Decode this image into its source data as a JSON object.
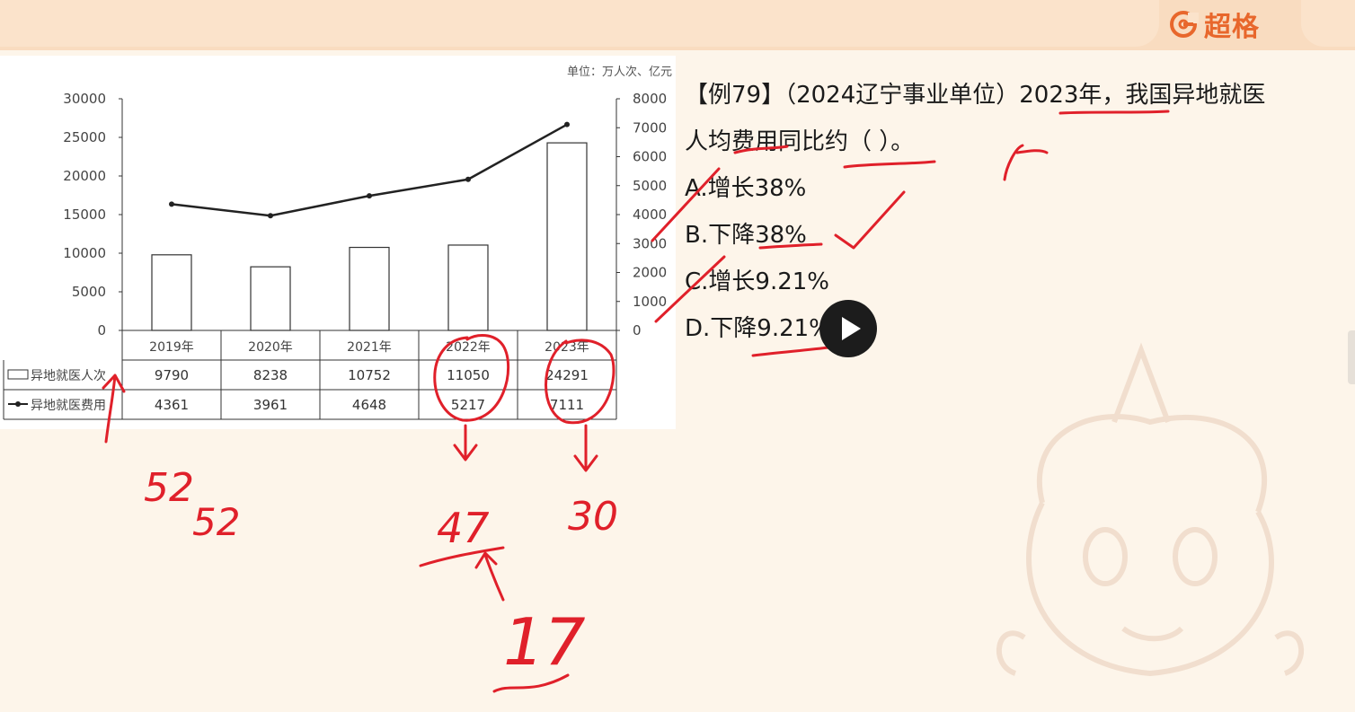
{
  "header": {
    "brand_name": "超格",
    "brand_color": "#e8672c",
    "brand_icon": "brand-logo-icon"
  },
  "chart_data": {
    "type": "bar+line",
    "unit_note": "单位：万人次、亿元",
    "categories": [
      "2019年",
      "2020年",
      "2021年",
      "2022年",
      "2023年"
    ],
    "left_axis": {
      "ticks": [
        "0",
        "5000",
        "10000",
        "15000",
        "20000",
        "25000",
        "30000"
      ],
      "ylim": [
        0,
        30000
      ]
    },
    "right_axis": {
      "ticks": [
        "0",
        "1000",
        "2000",
        "3000",
        "4000",
        "5000",
        "6000",
        "7000",
        "8000"
      ],
      "ylim": [
        0,
        8000
      ]
    },
    "series": [
      {
        "name": "异地就医人次",
        "type": "bar",
        "axis": "left",
        "values": [
          9790,
          8238,
          10752,
          11050,
          24291
        ]
      },
      {
        "name": "异地就医费用",
        "type": "line",
        "axis": "right",
        "values": [
          4361,
          3961,
          4648,
          5217,
          7111
        ]
      }
    ],
    "grid": false,
    "legend": "table-left"
  },
  "question": {
    "stem_line1": "【例79】（2024辽宁事业单位）2023年，我国异地就医",
    "stem_line2": "人均费用同比约（   ）。",
    "options": [
      "A.增长38%",
      "B.下降38%",
      "C.增长9.21%",
      "D.下降9.21%"
    ]
  },
  "handwriting": {
    "note_1": "52",
    "note_2": "52",
    "note_3": "47",
    "note_4": "30",
    "note_5": "17",
    "ink_color": "#e0202a"
  },
  "video": {
    "play_icon": "play-icon"
  },
  "watermark": {
    "icon": "mascot-watermark-icon"
  }
}
